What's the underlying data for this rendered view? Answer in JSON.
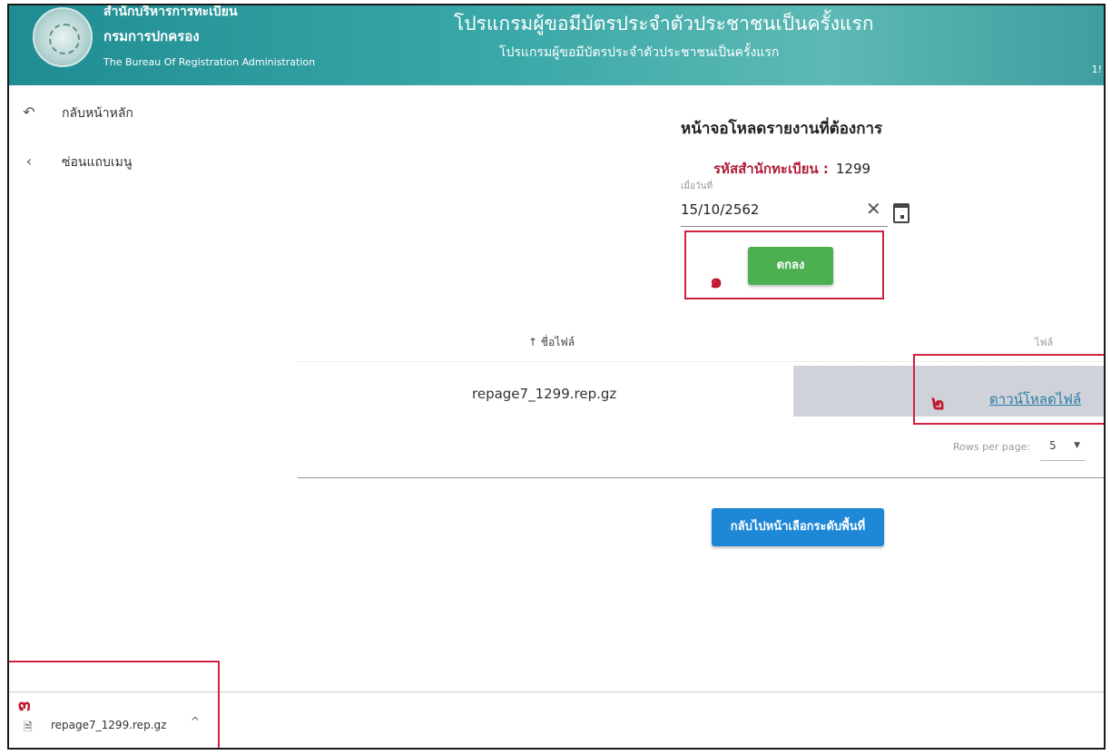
{
  "header": {
    "org_line1": "สำนักบริหารการทะเบียน",
    "org_line2": "กรมการปกครอง",
    "org_line3": "The Bureau Of Registration Administration",
    "title": "โปรแกรมผู้ขอมีบัตรประจำตัวประชาชนเป็นครั้งแรก",
    "subtitle": "โปรแกรมผู้ขอมีบัตรประจำตัวประชาชนเป็นครั้งแรก",
    "right_text": "1!"
  },
  "sidebar": {
    "items": [
      {
        "icon": "undo-icon",
        "glyph": "↶",
        "label": "กลับหน้าหลัก"
      },
      {
        "icon": "chevron-left-icon",
        "glyph": "‹",
        "label": "ซ่อนแถบเมนู"
      }
    ]
  },
  "main": {
    "title": "หน้าจอโหลดรายงานที่ต้องการ",
    "office_code_label": "รหัสสำนักทะเบียน :",
    "office_code_value": "1299",
    "date_label": "เมื่อวันที่",
    "date_value": "15/10/2562",
    "clear_glyph": "✕",
    "ok_button": "ตกลง",
    "back_button": "กลับไปหน้าเลือกระดับพื้นที่"
  },
  "annotations": {
    "step1": "๑",
    "step2": "๒",
    "step3": "๓"
  },
  "table": {
    "col_name": "↑ ชื่อไฟล์",
    "col_file": "ไฟล์",
    "rows": [
      {
        "name": "repage7_1299.rep.gz",
        "link": "ดาวน์โหลดไฟล์"
      }
    ],
    "rows_per_page_label": "Rows per page:",
    "rows_per_page_value": "5",
    "dropdown_glyph": "▼"
  },
  "download_bar": {
    "file_icon": "file-icon",
    "file_glyph": "🗎",
    "file_name": "repage7_1299.rep.gz",
    "chevron_glyph": "^"
  },
  "colors": {
    "header": "#2f9d9f",
    "ok_button": "#4caf50",
    "back_button": "#1e88d6",
    "highlight": "#d0213e",
    "code_label": "#b01e3a",
    "link": "#2a7aa6"
  }
}
